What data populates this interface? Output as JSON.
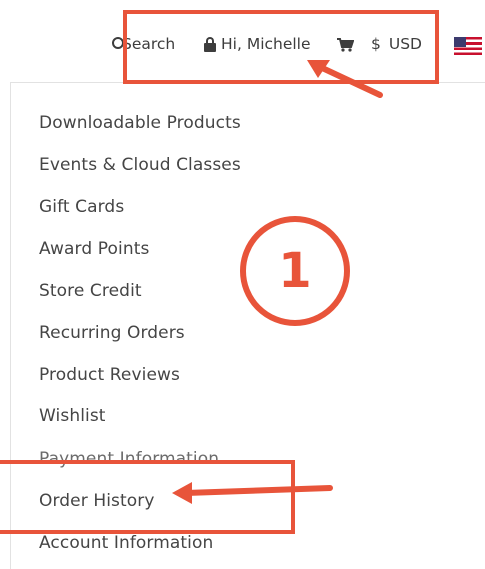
{
  "header": {
    "search_label": "Search",
    "greeting": "Hi, Michelle",
    "currency_symbol": "$",
    "currency_code": "USD",
    "icons": {
      "search": "search-icon",
      "account": "lock-icon",
      "cart": "cart-icon",
      "flag": "us-flag-icon"
    }
  },
  "account_menu": {
    "items": [
      {
        "label": "Downloadable Products"
      },
      {
        "label": "Events & Cloud Classes"
      },
      {
        "label": "Gift Cards"
      },
      {
        "label": "Award Points"
      },
      {
        "label": "Store Credit"
      },
      {
        "label": "Recurring Orders"
      },
      {
        "label": "Product Reviews"
      },
      {
        "label": "Wishlist"
      },
      {
        "label": "Payment Information"
      },
      {
        "label": "Order History"
      },
      {
        "label": "Account Information"
      }
    ]
  },
  "annotations": {
    "step_number": "1",
    "color": "#e8543a"
  }
}
